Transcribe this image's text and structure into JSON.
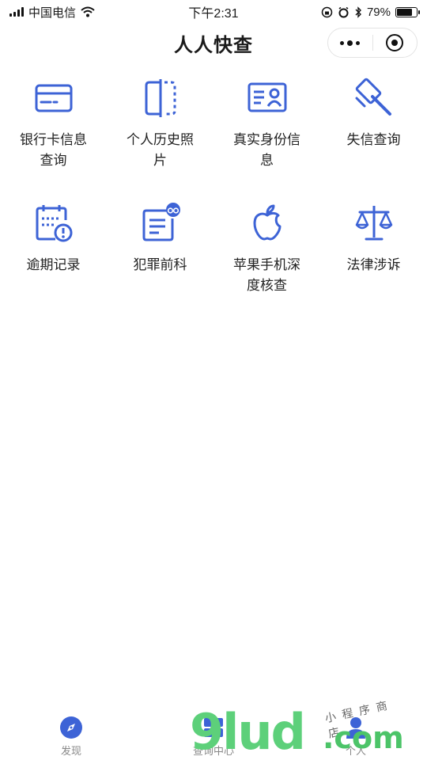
{
  "status_bar": {
    "carrier": "中国电信",
    "time": "下午2:31",
    "battery": "79%",
    "battery_level": 0.79
  },
  "nav": {
    "title": "人人快查"
  },
  "grid": {
    "items": [
      {
        "label": "银行卡信息查询",
        "icon": "bank-card-icon"
      },
      {
        "label": "个人历史照片",
        "icon": "photo-frame-icon"
      },
      {
        "label": "真实身份信息",
        "icon": "id-card-icon"
      },
      {
        "label": "失信查询",
        "icon": "gavel-icon"
      },
      {
        "label": "逾期记录",
        "icon": "overdue-calendar-icon"
      },
      {
        "label": "犯罪前科",
        "icon": "criminal-record-icon"
      },
      {
        "label": "苹果手机深度核查",
        "icon": "apple-icon"
      },
      {
        "label": "法律涉诉",
        "icon": "scales-icon"
      }
    ]
  },
  "tab_bar": {
    "tabs": [
      {
        "label": "发现",
        "icon": "compass-icon"
      },
      {
        "label": "查询中心",
        "icon": "query-center-icon"
      },
      {
        "label": "个人",
        "icon": "person-icon"
      }
    ]
  },
  "watermark": {
    "main": "9lud",
    "suffix": ".com",
    "sub": "小程序商店"
  },
  "colors": {
    "accent": "#3d63d6",
    "text": "#222222",
    "tab_inactive": "#888888",
    "watermark_green": "#5dd07a"
  }
}
